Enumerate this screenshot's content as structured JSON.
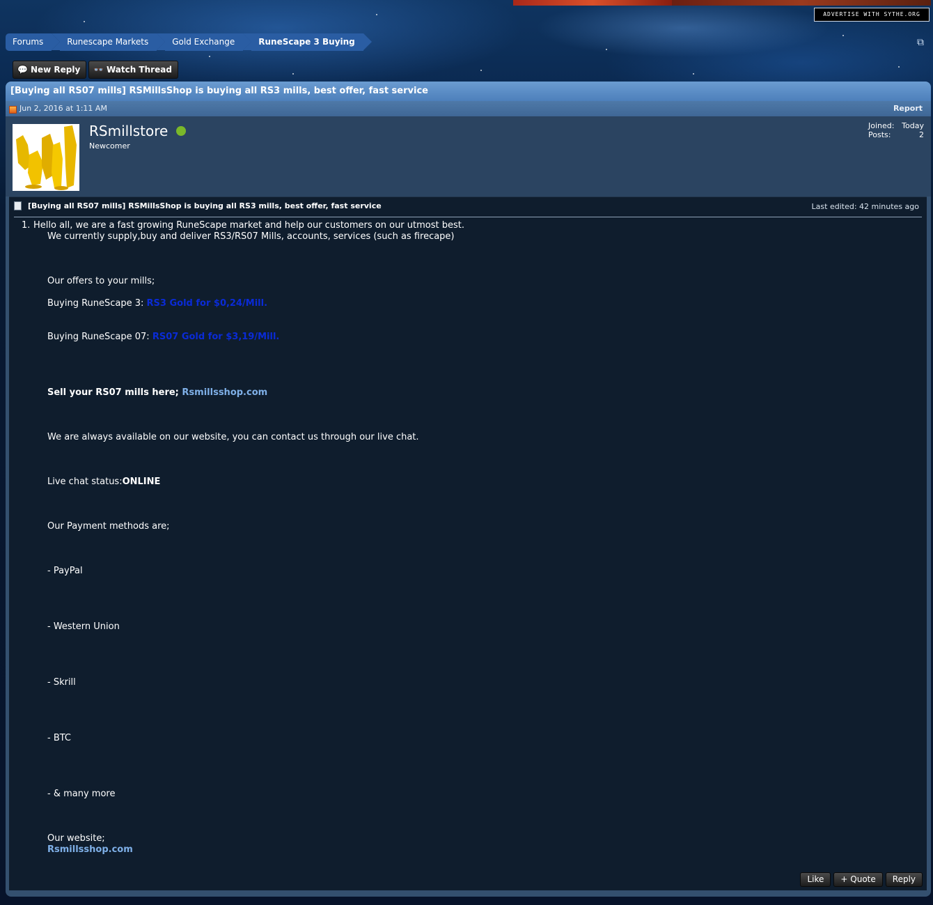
{
  "header": {
    "advertise": "Advertise with Sythe.org"
  },
  "breadcrumb": [
    {
      "label": "Forums"
    },
    {
      "label": "Runescape Markets"
    },
    {
      "label": "Gold Exchange"
    },
    {
      "label": "RuneScape 3 Buying"
    }
  ],
  "actions": {
    "new_reply": "New Reply",
    "watch_thread": "Watch Thread"
  },
  "thread": {
    "title": "[Buying all RS07 mills] RSMillsShop is buying all RS3 mills, best offer, fast service"
  },
  "post": {
    "date": "Jun 2, 2016 at 1:11 AM",
    "report": "Report",
    "user": {
      "name": "RSmillstore",
      "title": "Newcomer",
      "joined_label": "Joined:",
      "joined_value": "Today",
      "posts_label": "Posts:",
      "posts_value": "2"
    },
    "message": {
      "title": "[Buying all RS07 mills] RSMillsShop is buying all RS3 mills, best offer, fast service",
      "last_edited": "Last edited: 42 minutes ago",
      "number": "1.",
      "intro_1": "Hello all, we are a fast growing RuneScape market and help our customers on our utmost best.",
      "intro_2": "We currently supply,buy and deliver RS3/RS07 Mills, accounts, services (such as firecape)",
      "offers_heading": "Our offers to your mills;",
      "rs3_label": "Buying RuneScape 3: ",
      "rs3_price": "RS3 Gold for $0,24/Mill.",
      "rs07_label": "Buying RuneScape 07: ",
      "rs07_price": "RS07 Gold for $3,19/Mill.",
      "sell_label": "Sell your RS07 mills here; ",
      "sell_link": "Rsmillsshop.com",
      "available": "We are always available on our website, you can contact us through our live chat.",
      "live_chat_label": "Live chat status:",
      "live_chat_status": "ONLINE",
      "payment_heading": "Our Payment methods are;",
      "payment_methods": [
        "- PayPal",
        "- Western Union",
        "- Skrill",
        "- BTC",
        "- & many more"
      ],
      "website_label": "Our website;",
      "website_link": "Rsmillsshop.com"
    },
    "buttons": {
      "like": "Like",
      "quote": "+ Quote",
      "reply": "Reply"
    }
  }
}
